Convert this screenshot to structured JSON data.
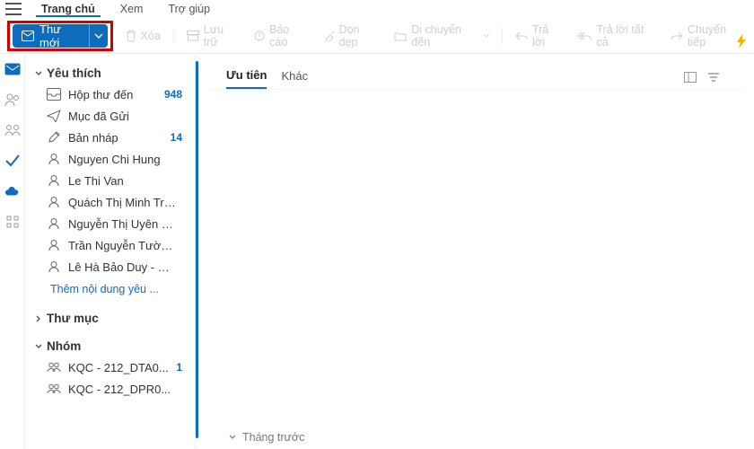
{
  "menubar": {
    "items": [
      "Trang chủ",
      "Xem",
      "Trợ giúp"
    ],
    "active": 0
  },
  "toolbar": {
    "new_mail": "Thư mới",
    "buttons": [
      "Xóa",
      "Lưu trữ",
      "Báo cáo",
      "Dọn dẹp",
      "Di chuyển đến",
      "Trả lời",
      "Trả lời tất cả",
      "Chuyển tiếp"
    ]
  },
  "sidebar": {
    "favorites": {
      "title": "Yêu thích",
      "items": [
        {
          "icon": "inbox",
          "label": "Hộp thư đến",
          "badge": "948"
        },
        {
          "icon": "sent",
          "label": "Mục đã Gửi",
          "badge": ""
        },
        {
          "icon": "draft",
          "label": "Bản nháp",
          "badge": "14"
        },
        {
          "icon": "person",
          "label": "Nguyen Chi Hung",
          "badge": ""
        },
        {
          "icon": "person",
          "label": "Le Thi Van",
          "badge": ""
        },
        {
          "icon": "person",
          "label": "Quách Thị Minh Tra...",
          "badge": ""
        },
        {
          "icon": "person",
          "label": "Nguyễn Thị Uyên P...",
          "badge": ""
        },
        {
          "icon": "person",
          "label": "Trần Nguyễn Tường...",
          "badge": ""
        },
        {
          "icon": "person",
          "label": "Lê Hà Bảo Duy - Kh...",
          "badge": ""
        }
      ],
      "add": "Thêm nội dung yêu ..."
    },
    "folders": {
      "title": "Thư mục"
    },
    "groups": {
      "title": "Nhóm",
      "items": [
        {
          "label": "KQC - 212_DTA0...",
          "badge": "1"
        },
        {
          "label": "KQC - 212_DPR0...",
          "badge": ""
        }
      ]
    }
  },
  "main": {
    "tabs": [
      "Ưu tiên",
      "Khác"
    ],
    "active": 0,
    "month_group": "Tháng trước"
  }
}
